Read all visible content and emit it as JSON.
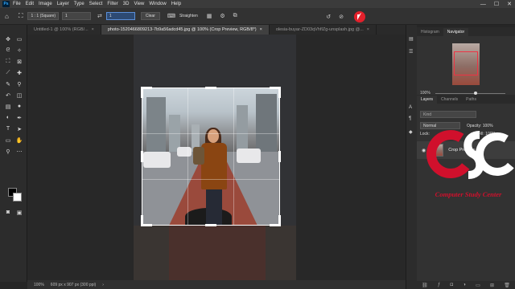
{
  "menubar": {
    "logo": "Ps",
    "items": [
      "File",
      "Edit",
      "Image",
      "Layer",
      "Type",
      "Select",
      "Filter",
      "3D",
      "View",
      "Window",
      "Help"
    ],
    "window_controls": [
      "—",
      "☐",
      "✕"
    ]
  },
  "options": {
    "ratio_preset": "1 : 1 (Square)",
    "width_value": "1",
    "height_value": "1",
    "clear_label": "Clear",
    "straighten_label": "Straighten",
    "icons": [
      "home-icon",
      "crop-icon",
      "swap-icon",
      "straighten-icon",
      "grid-overlay-icon",
      "settings-icon",
      "content-aware-icon",
      "reset-icon",
      "cancel-icon",
      "commit-icon"
    ],
    "accent_color": "#e3202b"
  },
  "tabs": [
    {
      "label": "Untitled-1 @ 100% (RGB/...",
      "active": false
    },
    {
      "label": "photo-1520466809213-7b9a56adcd45.jpg @ 100% (Crop Preview, RGB/8*)",
      "active": true
    },
    {
      "label": "olesia-buyar-ZD03qVhfIZg-unsplash.jpg @...",
      "active": false
    }
  ],
  "tab_close": "×",
  "status": {
    "zoom": "100%",
    "doc_size": "609 px x 907 px (300 ppi)",
    "arrow": "›"
  },
  "navigator": {
    "tabs": [
      "Histogram",
      "Navigator"
    ],
    "active_tab": "Navigator",
    "zoom": "100%",
    "zoom_level": 0.55
  },
  "layers": {
    "tabs": [
      "Layers",
      "Channels",
      "Paths"
    ],
    "active_tab": "Layers",
    "search_placeholder": "Kind",
    "blend_mode": "Normal",
    "opacity_label": "Opacity:",
    "opacity": "100%",
    "fill_label": "Fill:",
    "fill": "100%",
    "lock_label": "Lock:",
    "layer_name": "Crop Preview"
  },
  "watermark": {
    "letters": "CSC",
    "text": "Computer Study Center"
  }
}
